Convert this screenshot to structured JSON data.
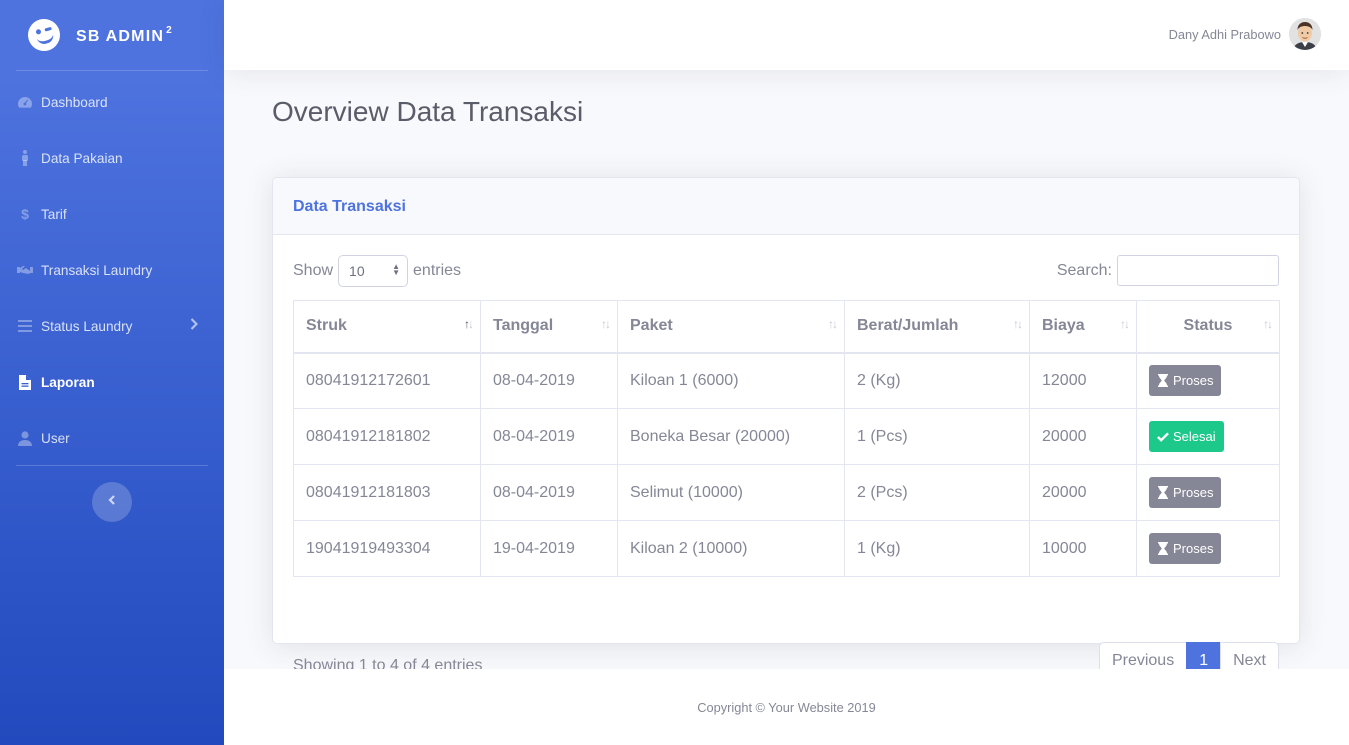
{
  "brand": {
    "name": "SB ADMIN",
    "sup": "2"
  },
  "sidebar": {
    "items": [
      {
        "label": "Dashboard",
        "icon": "tachometer-icon"
      },
      {
        "label": "Data Pakaian",
        "icon": "person-icon"
      },
      {
        "label": "Tarif",
        "icon": "dollar-icon"
      },
      {
        "label": "Transaksi Laundry",
        "icon": "handshake-icon"
      },
      {
        "label": "Status Laundry",
        "icon": "bars-icon",
        "has_children": true
      },
      {
        "label": "Laporan",
        "icon": "file-icon",
        "active": true
      },
      {
        "label": "User",
        "icon": "user-icon"
      }
    ]
  },
  "topbar": {
    "user_name": "Dany Adhi Prabowo"
  },
  "page": {
    "title": "Overview Data Transaksi"
  },
  "card": {
    "title": "Data Transaksi"
  },
  "table_controls": {
    "show_label": "Show",
    "entries_value": "10",
    "entries_label": "entries",
    "search_label": "Search:",
    "search_value": ""
  },
  "table": {
    "columns": [
      "Struk",
      "Tanggal",
      "Paket",
      "Berat/Jumlah",
      "Biaya",
      "Status"
    ],
    "rows": [
      {
        "struk": "08041912172601",
        "tanggal": "08-04-2019",
        "paket": "Kiloan 1 (6000)",
        "berat": "2 (Kg)",
        "biaya": "12000",
        "status": "Proses"
      },
      {
        "struk": "08041912181802",
        "tanggal": "08-04-2019",
        "paket": "Boneka Besar (20000)",
        "berat": "1 (Pcs)",
        "biaya": "20000",
        "status": "Selesai"
      },
      {
        "struk": "08041912181803",
        "tanggal": "08-04-2019",
        "paket": "Selimut (10000)",
        "berat": "2 (Pcs)",
        "biaya": "20000",
        "status": "Proses"
      },
      {
        "struk": "19041919493304",
        "tanggal": "19-04-2019",
        "paket": "Kiloan 2 (10000)",
        "berat": "1 (Kg)",
        "biaya": "10000",
        "status": "Proses"
      }
    ]
  },
  "info": "Showing 1 to 4 of 4 entries",
  "pagination": {
    "previous": "Previous",
    "current": "1",
    "next": "Next"
  },
  "footer": {
    "copyright": "Copyright © Your Website 2019"
  },
  "colors": {
    "primary": "#4e73df",
    "success": "#1cc88a",
    "secondary": "#858796"
  }
}
